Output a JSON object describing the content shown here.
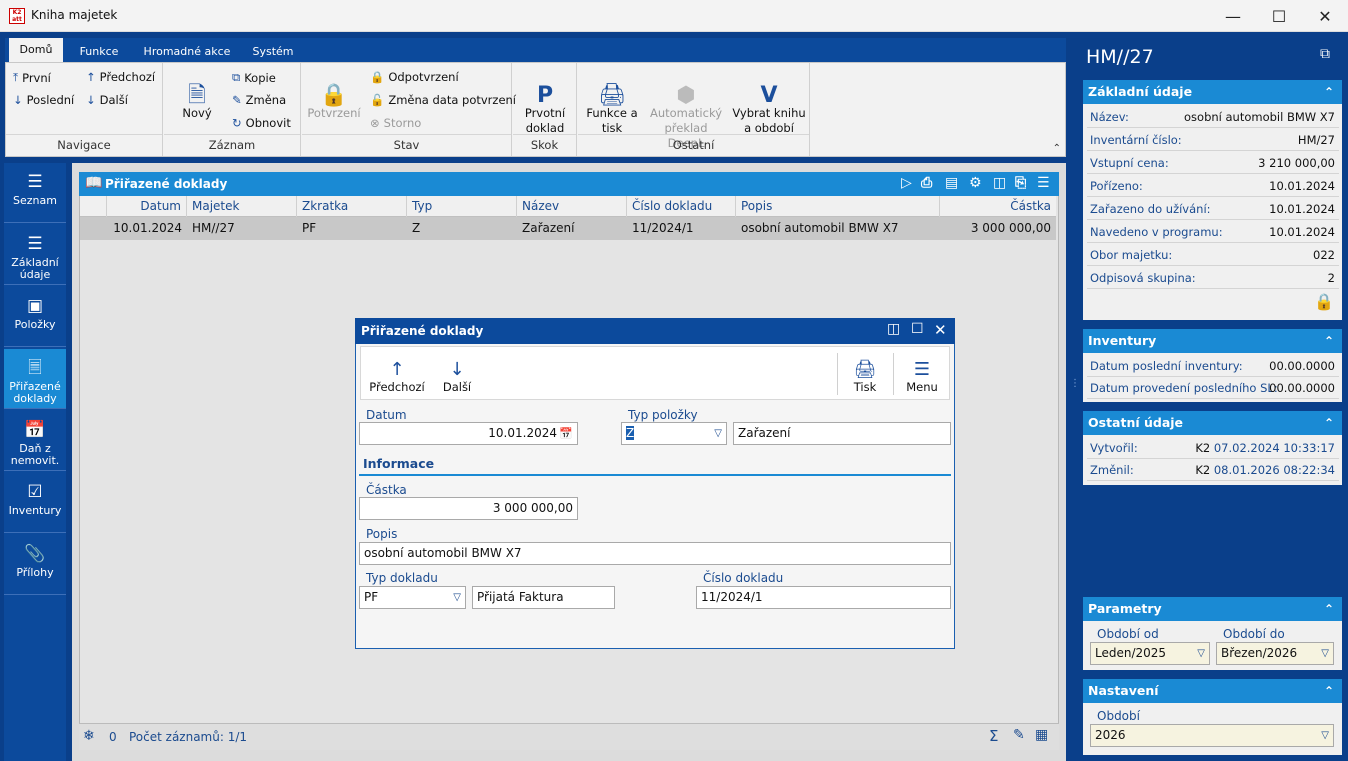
{
  "window": {
    "title": "Kniha majetek"
  },
  "ribbon": {
    "tabs": [
      "Domů",
      "Funkce",
      "Hromadné akce",
      "Systém"
    ],
    "navigace": {
      "prvni": "První",
      "predchozi": "Předchozí",
      "posledni": "Poslední",
      "dalsi": "Další",
      "label": "Navigace"
    },
    "zaznam": {
      "novy": "Nový",
      "kopie": "Kopie",
      "zmena": "Změna",
      "obnovit": "Obnovit",
      "label": "Záznam"
    },
    "stav": {
      "potvrzeni": "Potvrzení",
      "odpotvrzeni": "Odpotvrzení",
      "zmena_data": "Změna data potvrzení",
      "storno": "Storno",
      "label": "Stav"
    },
    "skok": {
      "prvotni_doklad": [
        "Prvotní",
        "doklad"
      ],
      "label": "Skok"
    },
    "ostatni": {
      "funkce_tisk": [
        "Funkce a",
        "tisk"
      ],
      "preklad": [
        "Automatický",
        "překlad DeepL"
      ],
      "vybrat": [
        "Vybrat knihu",
        "a období"
      ],
      "label": "Ostatní"
    }
  },
  "sidenav": [
    {
      "label": [
        "Seznam"
      ],
      "icon": "hamburger-icon"
    },
    {
      "label": [
        "Základní",
        "údaje"
      ],
      "icon": "list-icon"
    },
    {
      "label": [
        "Položky"
      ],
      "icon": "box-icon"
    },
    {
      "label": [
        "Přiřazené",
        "doklady"
      ],
      "icon": "documents-icon",
      "active": true
    },
    {
      "label": [
        "Daň z",
        "nemovit."
      ],
      "icon": "calendar-icon"
    },
    {
      "label": [
        "Inventury"
      ],
      "icon": "checklist-icon"
    },
    {
      "label": [
        "Přílohy"
      ],
      "icon": "paperclip-icon"
    }
  ],
  "grid": {
    "title": "Přiřazené doklady",
    "columns": [
      "Datum",
      "Majetek",
      "Zkratka",
      "Typ",
      "Název",
      "Číslo dokladu",
      "Popis",
      "Částka"
    ],
    "rows": [
      [
        "10.01.2024",
        "HM//27",
        "PF",
        "Z",
        "Zařazení",
        "11/2024/1",
        "osobní automobil BMW X7",
        "3 000 000,00"
      ]
    ],
    "footer": {
      "count_icon_value": "0",
      "record_count": "Počet záznamů: 1/1"
    }
  },
  "dialog": {
    "title": "Přiřazené doklady",
    "toolbar": {
      "prev": "Předchozí",
      "next": "Další",
      "print": "Tisk",
      "menu": "Menu"
    },
    "datum_label": "Datum",
    "datum_value": "10.01.2024",
    "typ_polozky_label": "Typ položky",
    "typ_polozky_code": "Z",
    "typ_polozky_name": "Zařazení",
    "informace_heading": "Informace",
    "castka_label": "Částka",
    "castka_value": "3 000 000,00",
    "popis_label": "Popis",
    "popis_value": "osobní automobil BMW X7",
    "typ_dokladu_label": "Typ dokladu",
    "typ_dokladu_code": "PF",
    "typ_dokladu_name": "Přijatá Faktura",
    "cislo_dokladu_label": "Číslo dokladu",
    "cislo_dokladu_value": "11/2024/1"
  },
  "right": {
    "title": "HM//27",
    "zakladni": {
      "header": "Základní údaje",
      "rows": [
        [
          "Název:",
          "osobní automobil BMW X7"
        ],
        [
          "Inventární číslo:",
          "HM/27"
        ],
        [
          "Vstupní cena:",
          "3 210 000,00"
        ],
        [
          "Pořízeno:",
          "10.01.2024"
        ],
        [
          "Zařazeno do užívání:",
          "10.01.2024"
        ],
        [
          "Navedeno v programu:",
          "10.01.2024"
        ],
        [
          "Obor majetku:",
          "022"
        ],
        [
          "Odpisová skupina:",
          "2"
        ]
      ]
    },
    "inventury": {
      "header": "Inventury",
      "rows": [
        [
          "Datum poslední inventury:",
          "00.00.0000"
        ],
        [
          "Datum provedení posledního SL:",
          "00.00.0000"
        ]
      ]
    },
    "ostatni": {
      "header": "Ostatní údaje",
      "vytvoril_label": "Vytvořil:",
      "vytvoril_user": "K2",
      "vytvoril_date": "07.02.2024 10:33:17",
      "zmenil_label": "Změnil:",
      "zmenil_user": "K2",
      "zmenil_date": "08.01.2026 08:22:34"
    },
    "parametry": {
      "header": "Parametry",
      "od_label": "Období od",
      "od_value": "Leden/2025",
      "do_label": "Období do",
      "do_value": "Březen/2026"
    },
    "nastaveni": {
      "header": "Nastavení",
      "obdobi_label": "Období",
      "obdobi_value": "2026"
    }
  },
  "colors": {
    "brand": "#0c4a9c",
    "accent": "#1a8ad4",
    "lock": "#2db84d"
  }
}
